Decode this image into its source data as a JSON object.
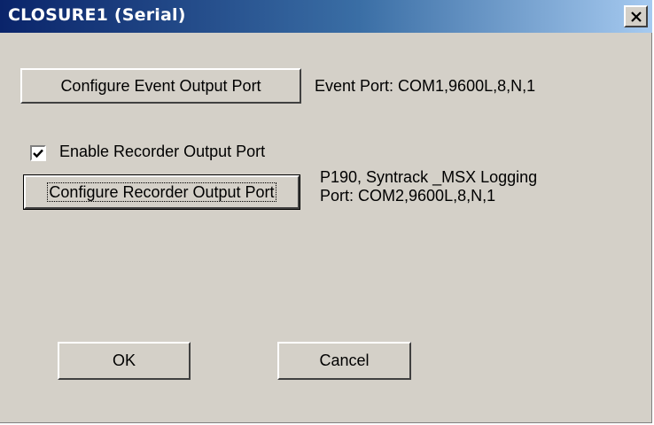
{
  "window": {
    "title": "CLOSURE1 (Serial)"
  },
  "event_port": {
    "button_label": "Configure Event Output Port",
    "status_text": "Event Port: COM1,9600L,8,N,1"
  },
  "recorder_port": {
    "enable_label": "Enable Recorder Output Port",
    "enabled": true,
    "button_label": "Configure Recorder Output Port",
    "status_line1": "P190, Syntrack _MSX Logging",
    "status_line2": "Port: COM2,9600L,8,N,1"
  },
  "footer": {
    "ok_label": "OK",
    "cancel_label": "Cancel"
  },
  "colors": {
    "dialog_background": "#d4d0c8",
    "title_gradient_start": "#0a246a",
    "title_gradient_end": "#a6caf0"
  },
  "icons": {
    "close": "close-icon",
    "checkmark": "checkmark-icon"
  }
}
